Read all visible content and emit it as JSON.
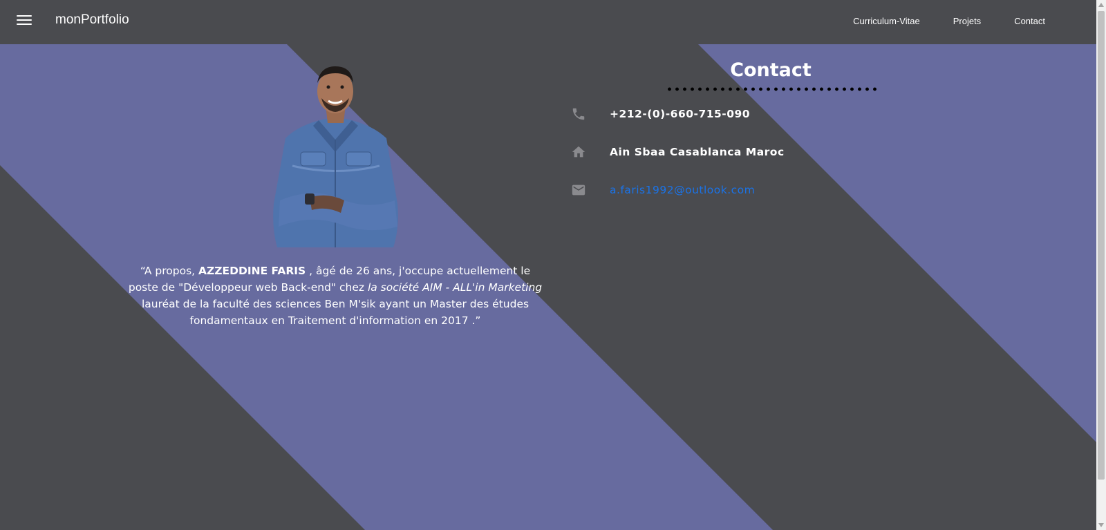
{
  "navbar": {
    "brand": "monPortfolio",
    "links": [
      "Curriculum-Vitae",
      "Projets",
      "Contact"
    ]
  },
  "about": {
    "quote_open": "“",
    "intro": "A propos, ",
    "name": "AZZEDDINE FARIS",
    "text1": " , âgé de 26 ans, j'occupe actuellement le poste de \"Développeur web Back-end\" chez ",
    "company": "la société AIM - ALL'in Marketing",
    "text2": " lauréat de la faculté des sciences Ben M'sik ayant un Master des études fondamentaux en Traitement d'information en 2017 .",
    "quote_close": "”"
  },
  "contact": {
    "title": "Contact",
    "phone": "+212-(0)-660-715-090",
    "address": "Ain Sbaa Casablanca Maroc",
    "email": "a.faris1992@outlook.com"
  },
  "icons": {
    "menu": "menu-icon",
    "phone": "phone-icon",
    "home": "home-icon",
    "email": "email-icon"
  },
  "colors": {
    "background": "#4a4b4f",
    "stripe": "#676b9f",
    "link": "#1a73e8",
    "icon": "#8a8a8e"
  }
}
